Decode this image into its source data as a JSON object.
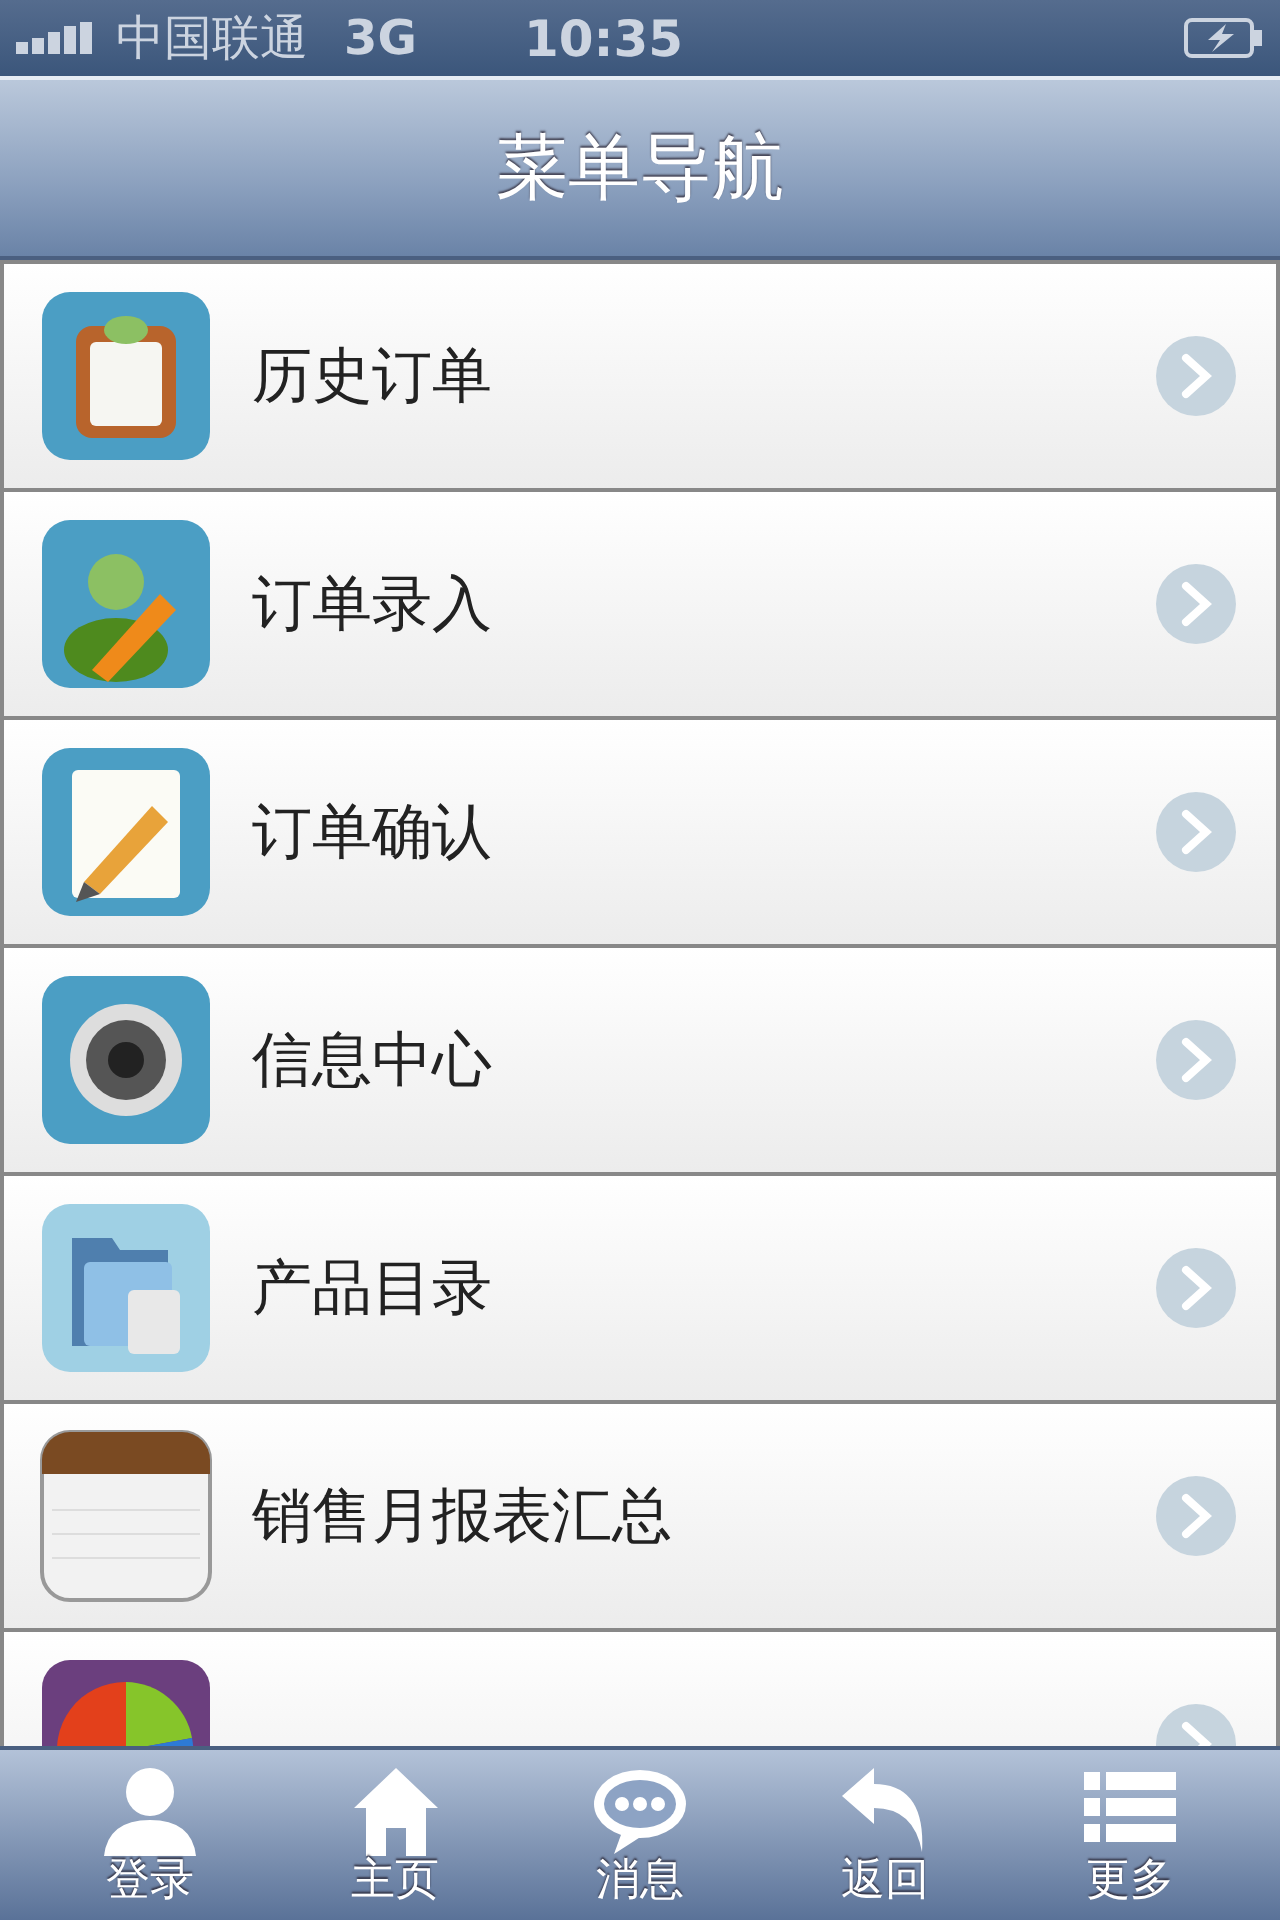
{
  "status_bar": {
    "carrier": "中国联通",
    "network": "3G",
    "time": "10:35"
  },
  "nav_bar": {
    "title": "菜单导航"
  },
  "menu": {
    "items": [
      {
        "kind": "full",
        "label": "历史订单"
      },
      {
        "kind": "full",
        "label": "订单录入"
      },
      {
        "kind": "full",
        "label": "订单确认"
      },
      {
        "kind": "full",
        "label": "信息中心"
      },
      {
        "kind": "full",
        "label": "产品目录"
      },
      {
        "kind": "full",
        "label": "销售月报表汇总"
      },
      {
        "kind": "cut_off"
      }
    ]
  },
  "tab_bar": {
    "items": [
      {
        "label": "登录"
      },
      {
        "label": "主页"
      },
      {
        "label": "消息"
      },
      {
        "label": "返回"
      },
      {
        "label": "更多"
      }
    ]
  }
}
